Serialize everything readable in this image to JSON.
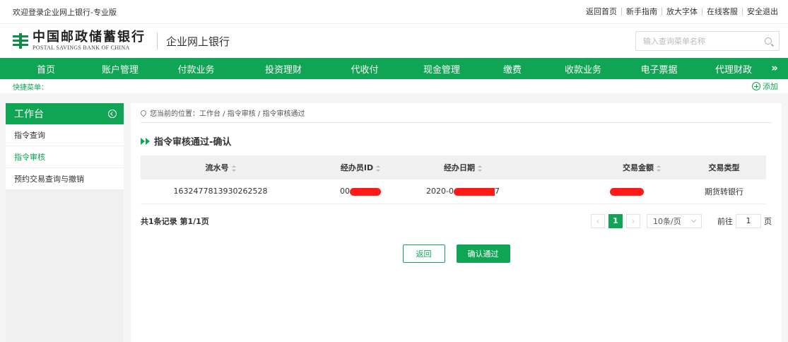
{
  "topbar": {
    "welcome": "欢迎登录企业网上银行-专业版",
    "links": [
      "返回首页",
      "新手指南",
      "放大字体",
      "在线客服",
      "安全退出"
    ]
  },
  "header": {
    "logo_cn": "中国邮政储蓄银行",
    "logo_en": "POSTAL SAVINGS BANK OF CHINA",
    "product": "企业网上银行",
    "search_placeholder": "输入查询菜单名称"
  },
  "nav": {
    "items": [
      "首页",
      "账户管理",
      "付款业务",
      "投资理财",
      "代收付",
      "现金管理",
      "缴费",
      "收款业务",
      "电子票据",
      "代理财政"
    ],
    "more": "»"
  },
  "quickbar": {
    "label": "快捷菜单：",
    "add": "添加"
  },
  "sidebar": {
    "title": "工作台",
    "items": [
      {
        "label": "指令查询",
        "active": false
      },
      {
        "label": "指令审核",
        "active": true
      },
      {
        "label": "预约交易查询与撤销",
        "active": false
      }
    ]
  },
  "breadcrumb": "您当前的位置：工作台 / 指令审核 / 指令审核通过",
  "section_title": "指令审核通过-确认",
  "table": {
    "headers": [
      "流水号",
      "经办员ID",
      "经办日期",
      "交易金额",
      "交易类型"
    ],
    "rows": [
      {
        "serial": "1632477813930262528",
        "operator_prefix": "00",
        "date_prefix": "2020-0",
        "date_suffix": "7",
        "type": "期货转银行"
      }
    ]
  },
  "pager": {
    "total": "共1条记录  第1/1页",
    "prev": "‹",
    "current": "1",
    "next": "›",
    "size": "10条/页",
    "goto_label": "前往",
    "goto_value": "1",
    "page_unit": "页"
  },
  "actions": {
    "back": "返回",
    "confirm": "确认通过"
  },
  "colors": {
    "brand_green": "#10a554",
    "redact": "#ff1a1a"
  }
}
